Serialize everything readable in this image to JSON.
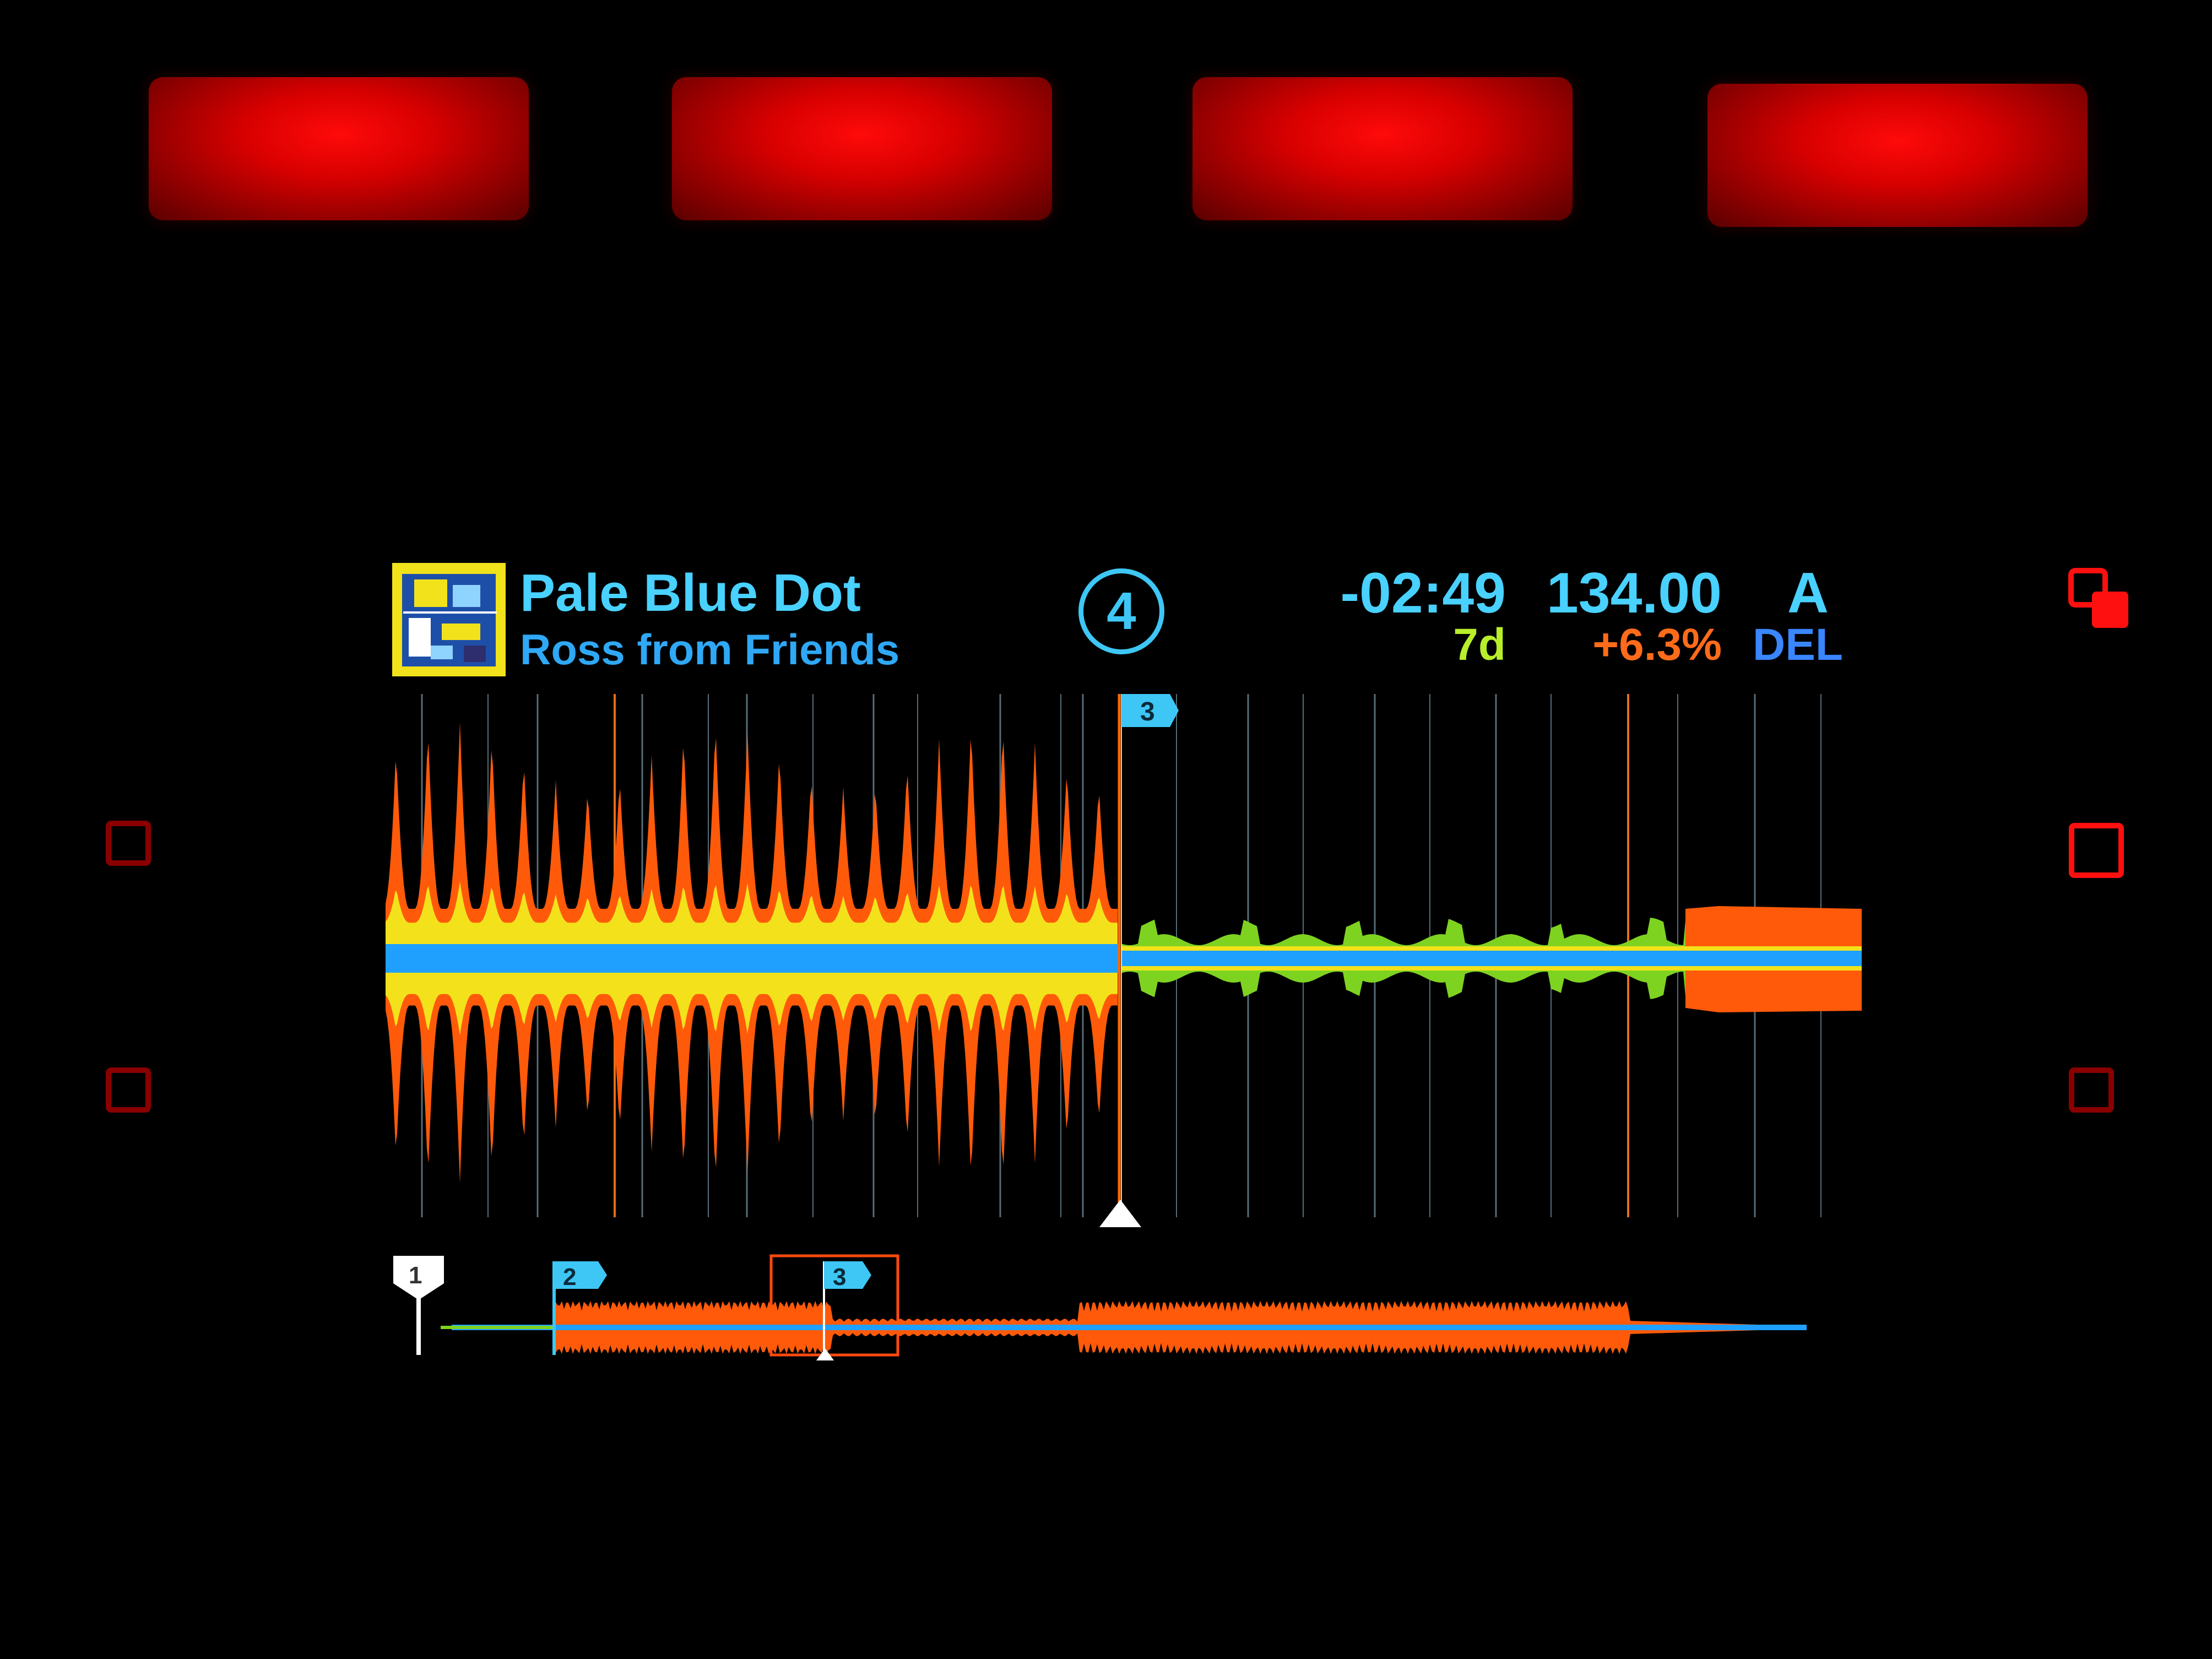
{
  "track": {
    "title": "Pale Blue Dot",
    "artist": "Ross from Friends"
  },
  "deck": {
    "number": "4"
  },
  "status": {
    "time_remaining": "-02:49",
    "bpm": "134.00",
    "sync_mode": "A",
    "key": "7d",
    "pitch": "+6.3%",
    "fx": "DEL"
  },
  "cues": {
    "main_cue_label": "3",
    "overview_cue_labels": [
      "1",
      "2",
      "3"
    ]
  },
  "colors": {
    "pad": "#e00000",
    "wave_low": "#1fa0ff",
    "wave_mid": "#f3e21b",
    "wave_high": "#ff5a0a",
    "wave_quiet": "#7ed321",
    "beat_grid": "#8fb4c8",
    "downbeat_grid": "#ff7a1a",
    "playhead": "#ff6a00",
    "cue": "#3ec7f5"
  },
  "icons": {
    "duplicate": "duplicate-icon",
    "playhead_marker": "triangle-up-icon",
    "album_art": "album-art"
  }
}
